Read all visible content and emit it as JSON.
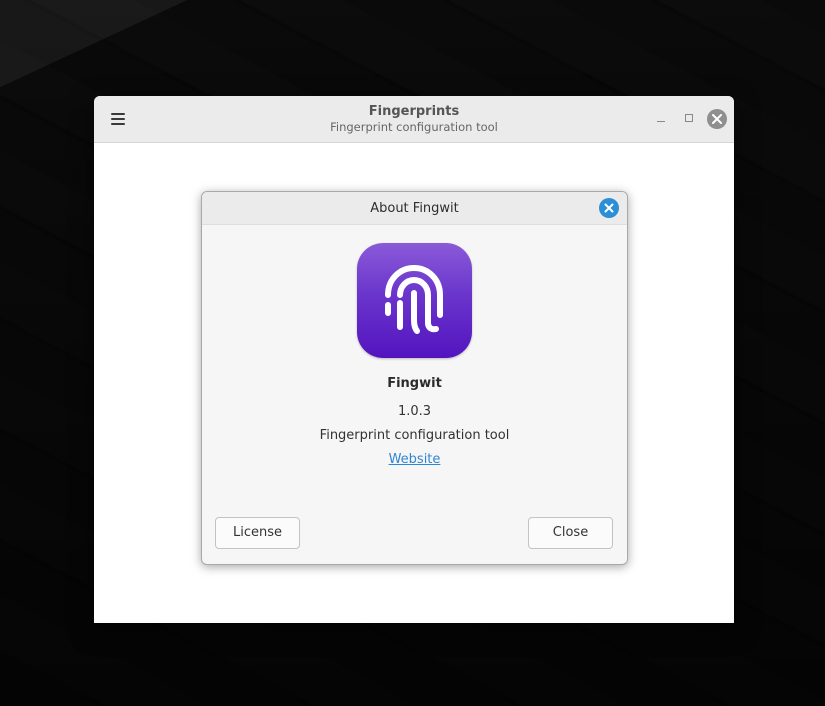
{
  "window": {
    "title": "Fingerprints",
    "subtitle": "Fingerprint configuration tool",
    "menu_icon": "hamburger-menu-icon",
    "controls": [
      "minimize-icon",
      "maximize-icon",
      "close-icon"
    ]
  },
  "about_dialog": {
    "title": "About Fingwit",
    "close_icon": "close-icon",
    "app_icon": "fingerprint-icon",
    "app_name": "Fingwit",
    "version": "1.0.3",
    "description": "Fingerprint configuration tool",
    "website_label": "Website",
    "buttons": {
      "license": "License",
      "close": "Close"
    }
  },
  "colors": {
    "accent": "#2a8fd6",
    "link": "#2f86d4",
    "icon_top": "#8a5ad8",
    "icon_bottom": "#5314bf"
  }
}
